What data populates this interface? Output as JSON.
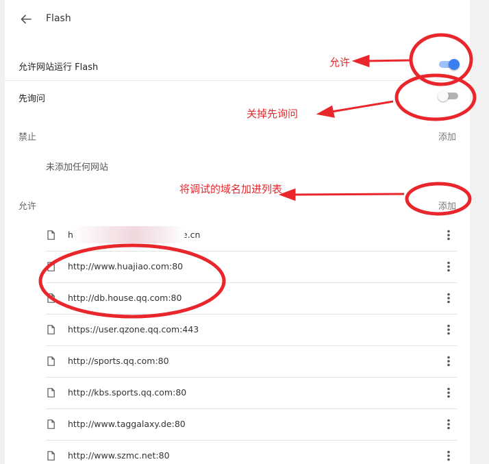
{
  "header": {
    "title": "Flash",
    "back_icon": "arrow-back-icon"
  },
  "settings": {
    "allow_flash": {
      "label": "允许网站运行 Flash",
      "state": "on"
    },
    "ask_first": {
      "label": "先询问",
      "state": "off"
    }
  },
  "blocked": {
    "label": "禁止",
    "add_label": "添加",
    "empty_text": "未添加任何网站"
  },
  "allowed": {
    "label": "允许",
    "add_label": "添加",
    "sites": [
      {
        "url_start": "ht",
        "url_end": "e.cn"
      },
      {
        "url": "http://www.huajiao.com:80"
      },
      {
        "url": "http://db.house.qq.com:80"
      },
      {
        "url": "https://user.qzone.qq.com:443"
      },
      {
        "url": "http://sports.qq.com:80"
      },
      {
        "url": "http://kbs.sports.qq.com:80"
      },
      {
        "url": "http://www.taggalaxy.de:80"
      },
      {
        "url": "http://www.szmc.net:80"
      }
    ]
  },
  "annotations": {
    "allow": "允许",
    "turn_off_ask": "关掉先询问",
    "add_domain": "将调试的域名加进列表"
  },
  "colors": {
    "accent": "#3b7ff2",
    "toggle_on_track": "#9cc2f9",
    "toggle_off_track": "#b2b2b2",
    "annotation_red": "#e8262b"
  }
}
